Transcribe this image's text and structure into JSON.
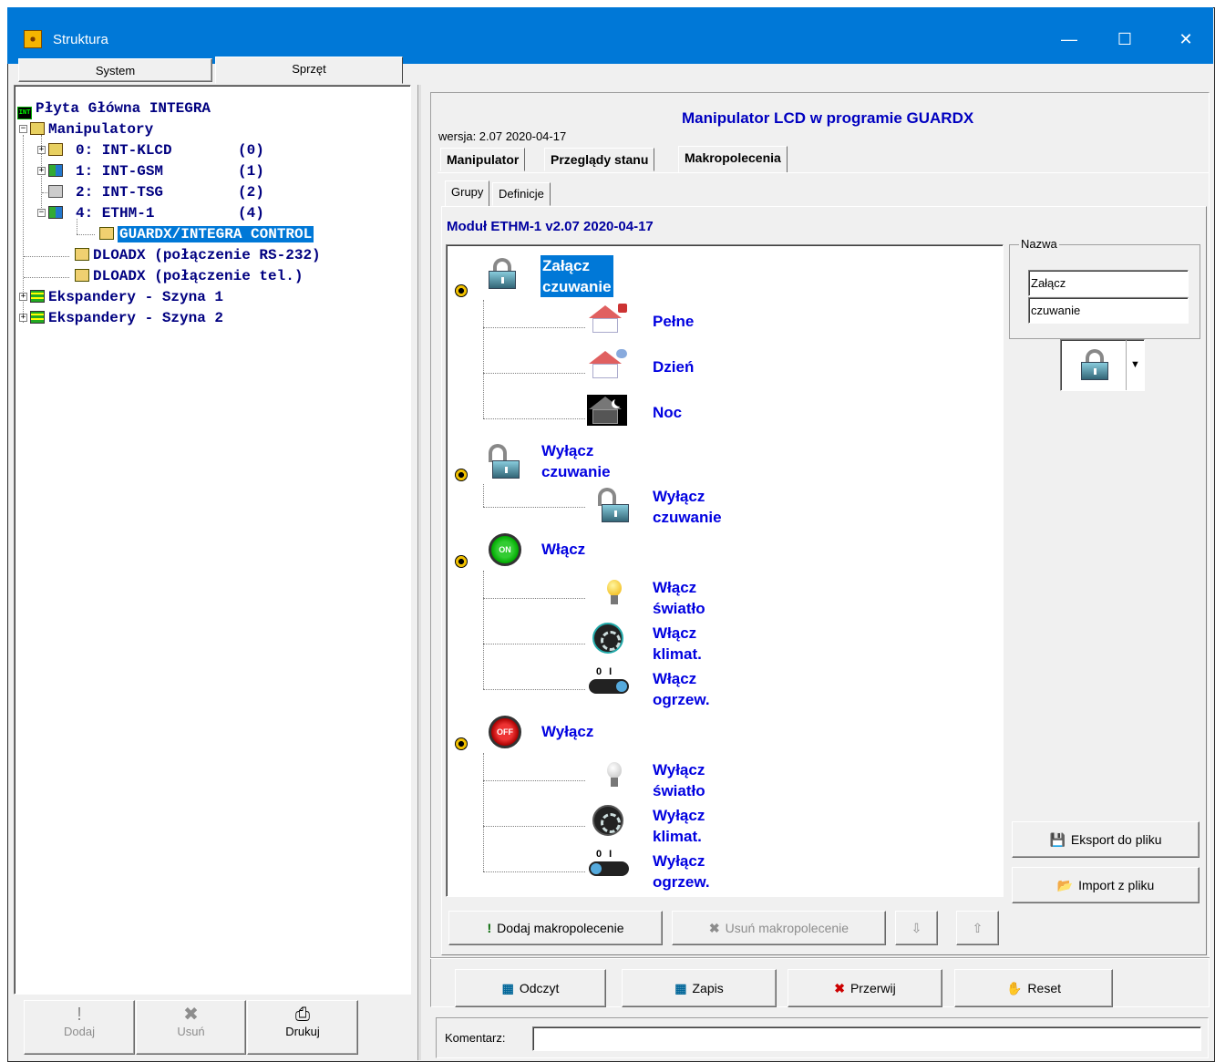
{
  "window": {
    "title": "Struktura"
  },
  "top_tabs": [
    "System",
    "Sprzęt"
  ],
  "tree": {
    "root": "Płyta Główna INTEGRA",
    "manipulatory": "Manipulatory",
    "devices": [
      {
        "label": "0: INT-KLCD",
        "num": "(0)"
      },
      {
        "label": "1: INT-GSM",
        "num": "(1)"
      },
      {
        "label": "2: INT-TSG",
        "num": "(2)"
      },
      {
        "label": "4: ETHM-1",
        "num": "(4)"
      }
    ],
    "selected": "GUARDX/INTEGRA CONTROL",
    "dloadx_rs": "DLOADX (połączenie RS-232)",
    "dloadx_tel": "DLOADX (połączenie tel.)",
    "exp1": "Ekspandery - Szyna 1",
    "exp2": "Ekspandery - Szyna 2"
  },
  "left_buttons": {
    "add": "Dodaj",
    "remove": "Usuń",
    "print": "Drukuj"
  },
  "panel": {
    "title": "Manipulator LCD w programie GUARDX",
    "version": "wersja: 2.07 2020-04-17",
    "tabs": [
      "Manipulator",
      "Przeglądy stanu",
      "Makropolecenia"
    ],
    "subtabs": [
      "Grupy",
      "Definicje"
    ],
    "module": "Moduł ETHM-1 v2.07 2020-04-17"
  },
  "macros": {
    "g1": {
      "l1": "Załącz",
      "l2": "czuwanie",
      "items": [
        "Pełne",
        "Dzień",
        "Noc"
      ]
    },
    "g2": {
      "l1": "Wyłącz",
      "l2": "czuwanie",
      "item_l1": "Wyłącz",
      "item_l2": "czuwanie"
    },
    "g3": {
      "label": "Włącz",
      "i1a": "Włącz",
      "i1b": "światło",
      "i2a": "Włącz",
      "i2b": "klimat.",
      "i3a": "Włącz",
      "i3b": "ogrzew."
    },
    "g4": {
      "label": "Wyłącz",
      "i1a": "Wyłącz",
      "i1b": "światło",
      "i2a": "Wyłącz",
      "i2b": "klimat.",
      "i3a": "Wyłącz",
      "i3b": "ogrzew."
    },
    "on_text": "ON",
    "off_text": "OFF"
  },
  "name_panel": {
    "legend": "Nazwa",
    "line1": "Załącz",
    "line2": "czuwanie"
  },
  "macro_buttons": {
    "add": "Dodaj makropolecenie",
    "remove": "Usuń makropolecenie"
  },
  "side_buttons": {
    "export": "Eksport do pliku",
    "import": "Import z pliku"
  },
  "bottom_buttons": {
    "read": "Odczyt",
    "write": "Zapis",
    "stop": "Przerwij",
    "reset": "Reset"
  },
  "comment": {
    "label": "Komentarz:",
    "value": ""
  },
  "colors": {
    "titlebar": "#0078d7",
    "selection": "#0078d7",
    "macro_text": "#0000e0"
  }
}
